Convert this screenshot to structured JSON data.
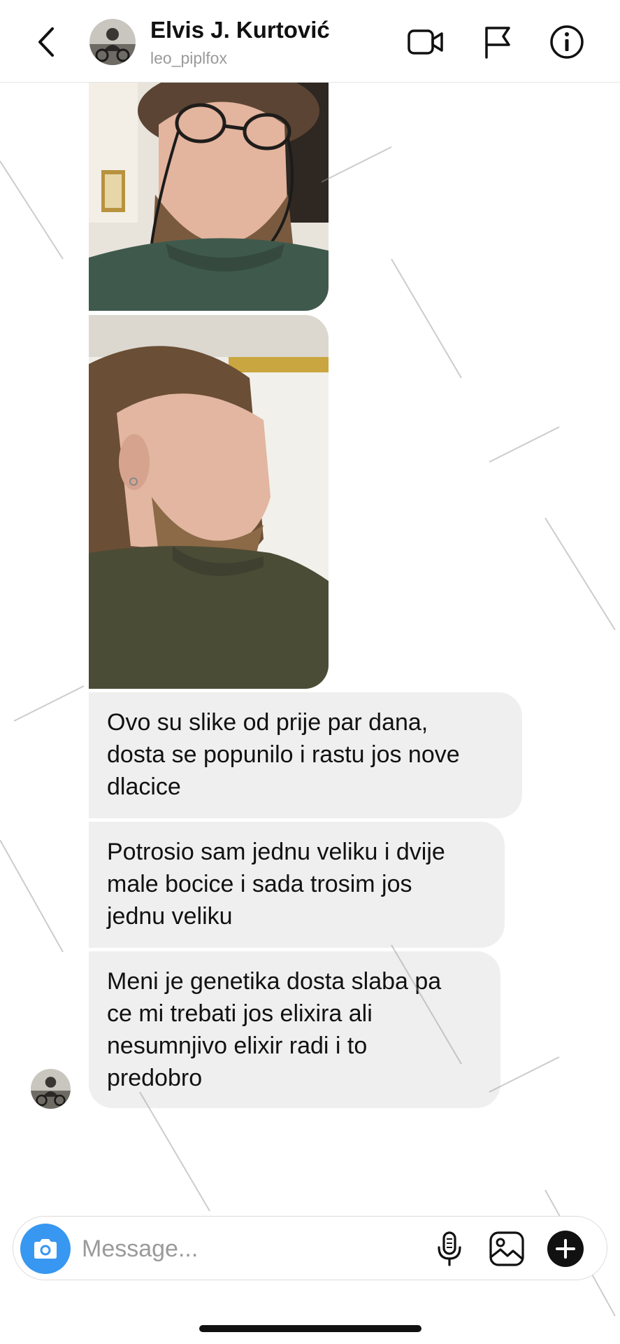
{
  "header": {
    "name": "Elvis J. Kurtović",
    "username": "leo_piplfox"
  },
  "icons": {
    "back": "chevron-left-icon",
    "video": "video-camera-icon",
    "report": "flag-icon",
    "info": "info-icon",
    "camera": "camera-icon",
    "mic": "microphone-icon",
    "gallery": "image-icon",
    "more": "plus-icon"
  },
  "messages": [
    {
      "type": "image",
      "description": "photo-front"
    },
    {
      "type": "image",
      "description": "photo-side"
    },
    {
      "type": "text",
      "text": "Ovo su slike od prije par dana,\ndosta se popunilo i rastu jos nove\ndlacice"
    },
    {
      "type": "text",
      "text": "Potrosio sam jednu veliku i dvije\nmale bocice i sada trosim jos\njednu veliku"
    },
    {
      "type": "text",
      "text": "Meni je genetika dosta slaba pa\nce mi trebati jos elixira ali\nnesumnjivo elixir radi i to\npredobro"
    }
  ],
  "composer": {
    "placeholder": "Message..."
  },
  "colors": {
    "accent": "#3897f0",
    "bubble": "#efefef",
    "text": "#111111",
    "muted": "#9a9a9a"
  }
}
